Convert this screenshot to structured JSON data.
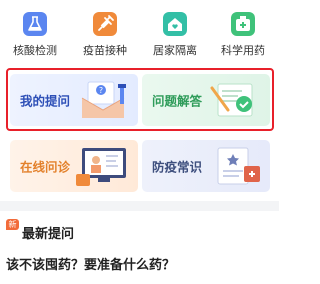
{
  "quick_icons": [
    {
      "label": "核酸检测",
      "icon": "flask-icon",
      "color": "#5b86f0"
    },
    {
      "label": "疫苗接种",
      "icon": "syringe-icon",
      "color": "#f08a3a"
    },
    {
      "label": "居家隔离",
      "icon": "home-heart-icon",
      "color": "#33bfa6"
    },
    {
      "label": "科学用药",
      "icon": "medicine-kit-icon",
      "color": "#3fc27a"
    }
  ],
  "cards": {
    "my_questions": "我的提问",
    "answers": "问题解答",
    "online_consult": "在线问诊",
    "prevention_knowledge": "防疫常识"
  },
  "latest": {
    "badge": "新",
    "title": "最新提问",
    "question": "该不该囤药？要准备什么药？"
  },
  "colors": {
    "highlight": "#e8202a",
    "badge": "#f26b3a"
  }
}
